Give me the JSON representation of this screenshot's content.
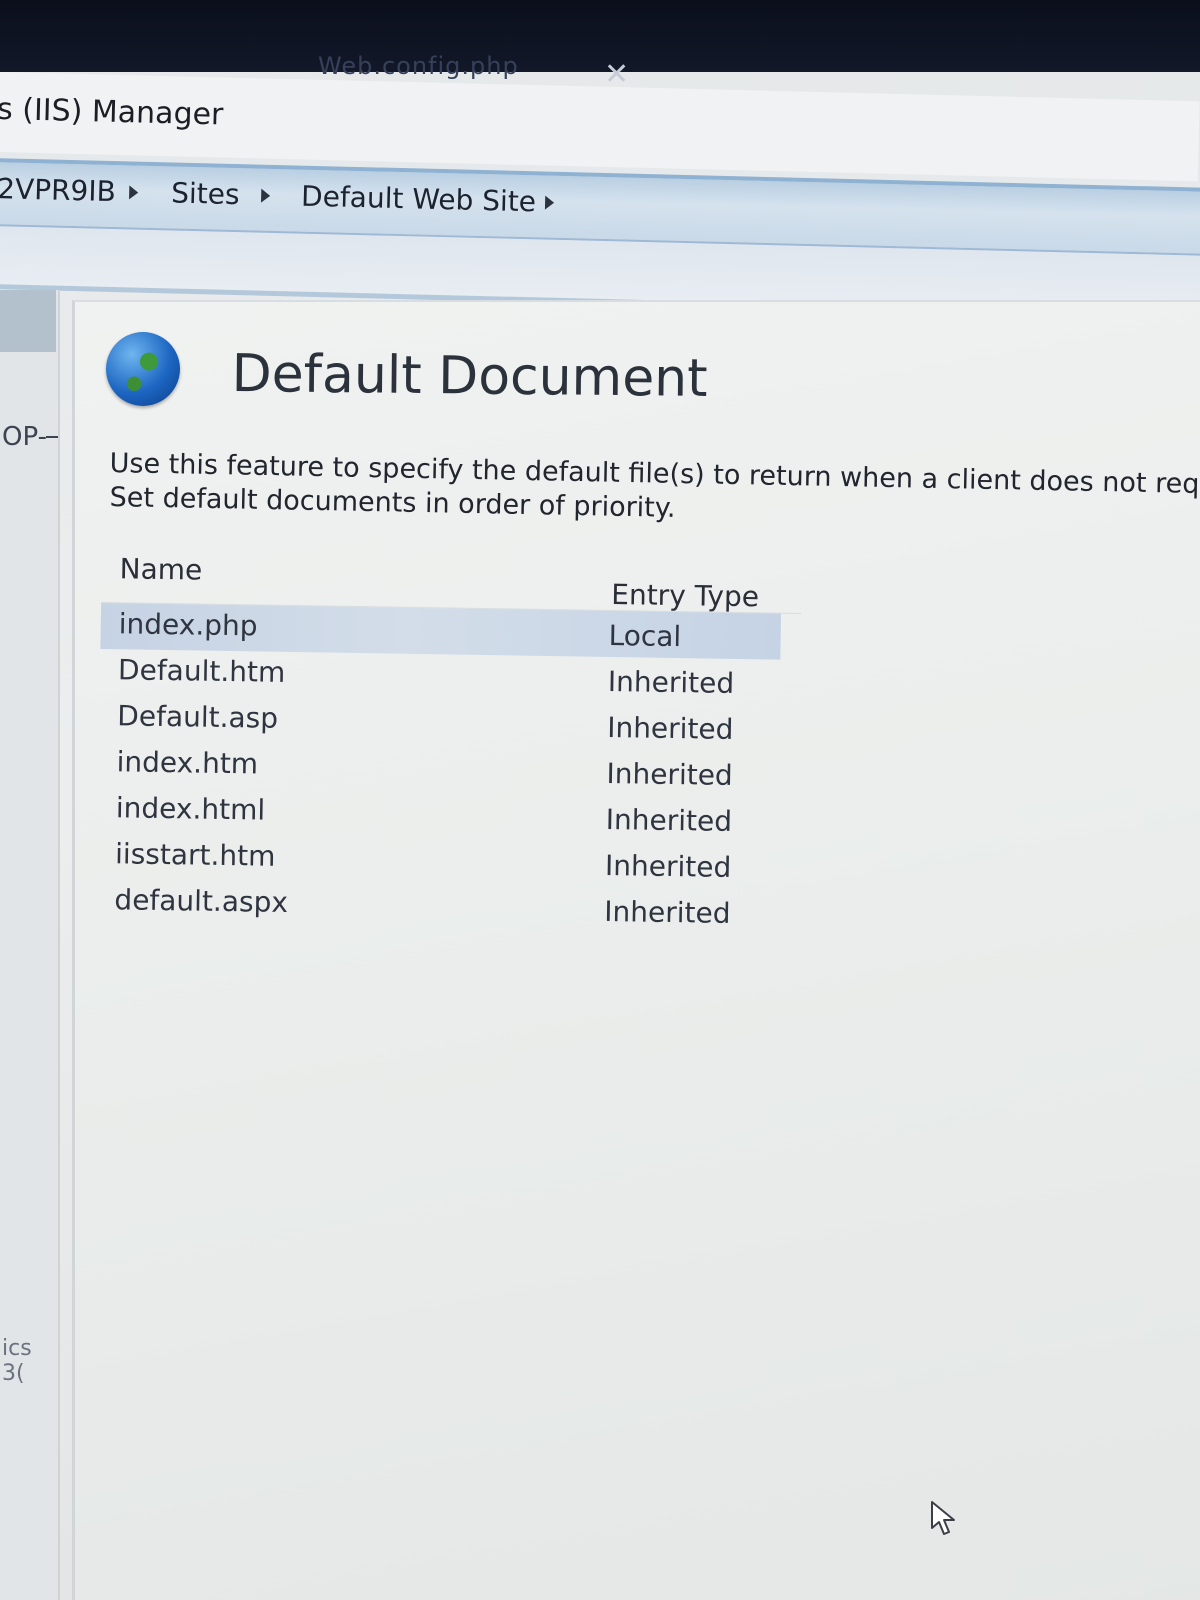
{
  "tab": {
    "label": "Web.config.php",
    "close_glyph": "✕"
  },
  "window": {
    "title": "s (IIS) Manager"
  },
  "breadcrumb": {
    "items": [
      "2VPR9IB",
      "Sites",
      "Default Web Site"
    ]
  },
  "connections": {
    "node_label": "OP-",
    "footer_label": "ics 3("
  },
  "feature": {
    "icon": "globe-icon",
    "title": "Default Document",
    "description_line1": "Use this feature to specify the default file(s) to return when a client does not request a",
    "description_line2": "Set default documents in order of priority."
  },
  "documents": {
    "columns": [
      "Name",
      "Entry Type"
    ],
    "rows": [
      {
        "name": "index.php",
        "type": "Local",
        "selected": true
      },
      {
        "name": "Default.htm",
        "type": "Inherited"
      },
      {
        "name": "Default.asp",
        "type": "Inherited"
      },
      {
        "name": "index.htm",
        "type": "Inherited"
      },
      {
        "name": "index.html",
        "type": "Inherited"
      },
      {
        "name": "iisstart.htm",
        "type": "Inherited"
      },
      {
        "name": "default.aspx",
        "type": "Inherited"
      }
    ]
  },
  "colors": {
    "address_bar": "#c9d9e8",
    "selection": "#c6d3e4",
    "taskbar": "#0b0f1c"
  }
}
